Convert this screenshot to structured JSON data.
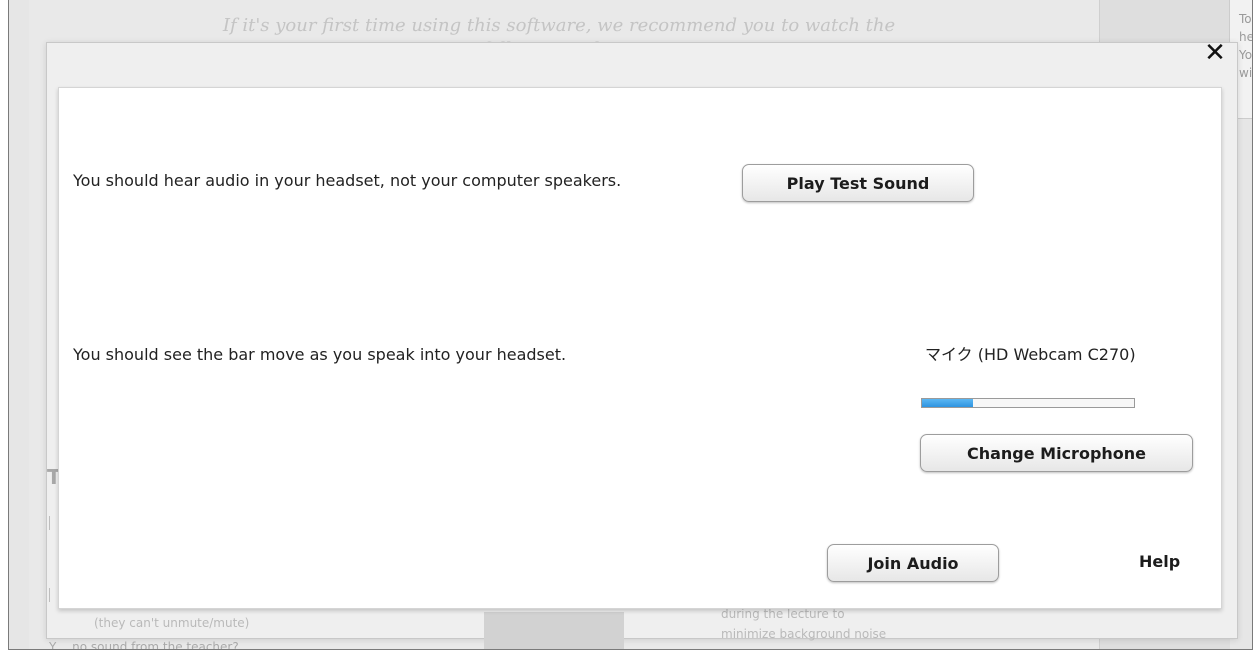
{
  "background": {
    "intro_text": "If it's your first time using this software, we recommend you to watch the following videos.",
    "right_panel_text": "To\nhe\nYo\nwi",
    "heading_letter": "T",
    "bottom_left_text": "(they can't unmute/mute)",
    "bottom_right_text": "during the lecture to\nminimize background noise",
    "bottom_row_text": "Y… no sound from the teacher?"
  },
  "dialog": {
    "speaker_instruction": "You should hear audio in your headset, not your computer speakers.",
    "play_test_sound_label": "Play Test Sound",
    "mic_instruction": "You should see the bar move as you speak into your headset.",
    "microphone_name": "マイク (HD Webcam C270)",
    "mic_level_fraction": 0.24,
    "change_microphone_label": "Change Microphone",
    "join_audio_label": "Join Audio",
    "help_label": "Help",
    "close_icon": "close-icon"
  },
  "colors": {
    "level_fill": "#2e94e0",
    "dialog_background": "#ffffff",
    "overlay_background": "#e6e6e6"
  }
}
